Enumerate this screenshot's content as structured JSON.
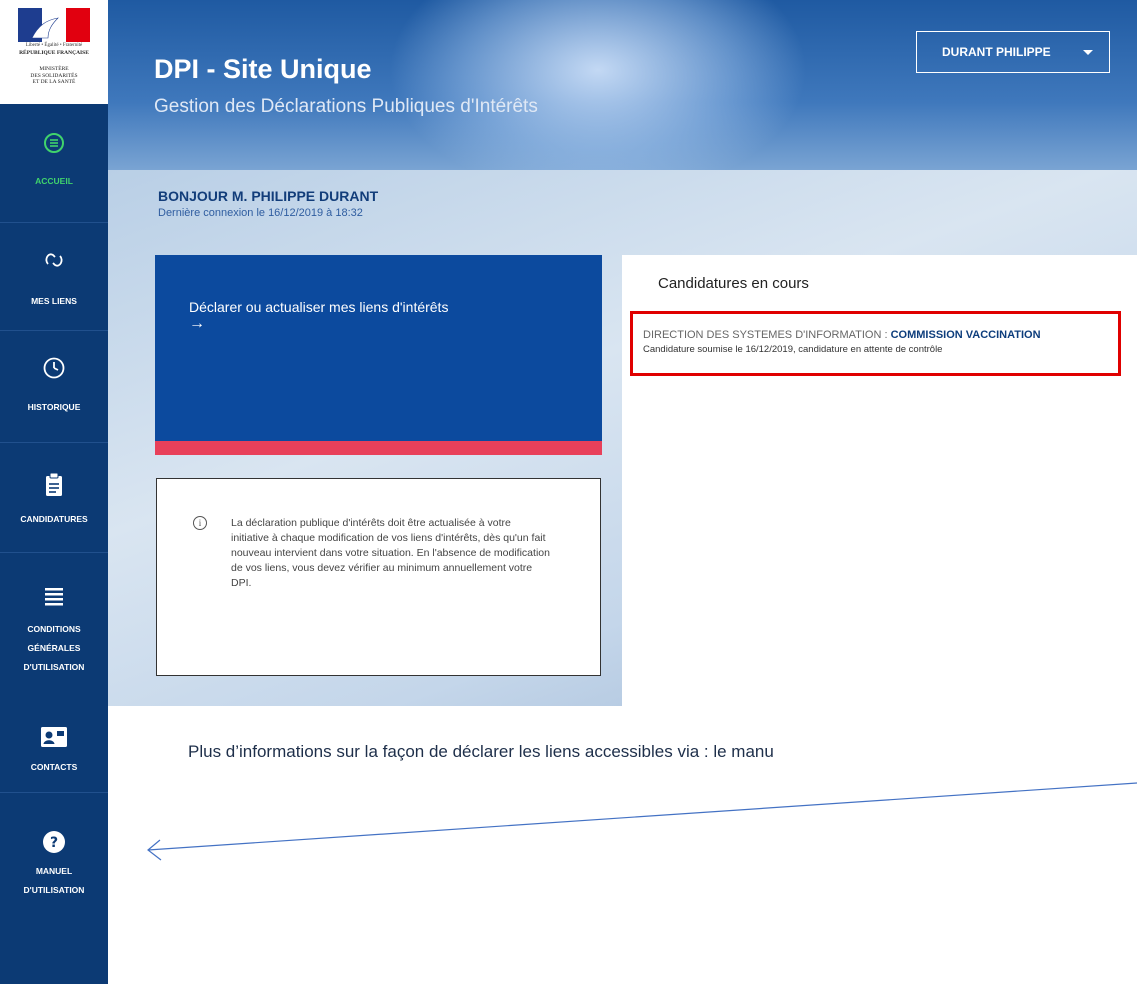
{
  "logo": {
    "motto": "Liberté • Égalité • Fraternité",
    "republic": "RÉPUBLIQUE FRANÇAISE",
    "ministry": [
      "MINISTÈRE",
      "DES SOLIDARITÉS",
      "ET DE LA SANTÉ"
    ],
    "colors": {
      "blue": "#1e3d8f",
      "red": "#e1000f"
    }
  },
  "sidebar": {
    "items": [
      {
        "label": "ACCUEIL",
        "icon": "list-icon",
        "active": true
      },
      {
        "label": "MES LIENS",
        "icon": "link-icon"
      },
      {
        "label": "HISTORIQUE",
        "icon": "clock-icon"
      },
      {
        "label": "CANDIDATURES",
        "icon": "clipboard-icon"
      },
      {
        "label_lines": [
          "CONDITIONS",
          "GÉNÉRALES",
          "D'UTILISATION"
        ],
        "icon": "menu-lines-icon"
      },
      {
        "label": "CONTACTS",
        "icon": "contact-card-icon"
      },
      {
        "label_lines": [
          "MANUEL",
          "D'UTILISATION"
        ],
        "icon": "help-icon"
      }
    ],
    "colors": {
      "background": "#0c3a74",
      "active": "#40d36c"
    }
  },
  "header": {
    "title": "DPI - Site Unique",
    "subtitle": "Gestion des Déclarations Publiques d'Intérêts",
    "user_menu": "DURANT PHILIPPE"
  },
  "main": {
    "greeting": "BONJOUR M. PHILIPPE DURANT",
    "last_login": "Dernière connexion le 16/12/2019 à 18:32",
    "declare_card": {
      "label": "Déclarer ou actualiser mes liens d'intérêts",
      "arrow": "→"
    },
    "info": {
      "text": "La déclaration publique d'intérêts doit être actualisée à votre initiative à chaque modification de vos liens d'intérêts, dès qu'un fait nouveau intervient dans votre situation. En l'absence de modification de vos liens, vous devez vérifier au minimum annuellement votre DPI."
    },
    "candidatures": {
      "title": "Candidatures en cours",
      "item": {
        "department": "DIRECTION DES SYSTEMES D'INFORMATION : ",
        "commission": "COMMISSION VACCINATION",
        "status": "Candidature soumise le 16/12/2019, candidature en attente de contrôle"
      }
    }
  },
  "annotation": {
    "text": "Plus d’informations sur la façon de déclarer les liens accessibles via : le manu",
    "highlight_color": "#e00000",
    "arrow_color": "#4472c4"
  }
}
